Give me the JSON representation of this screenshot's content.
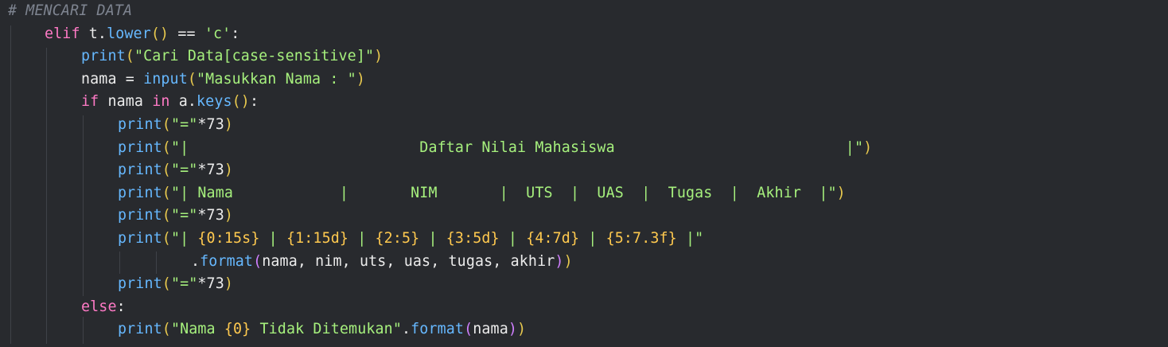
{
  "editor": {
    "lines": [
      {
        "indent": 0,
        "tokens": [
          {
            "t": "comment",
            "v": "# MENCARI DATA"
          }
        ]
      },
      {
        "indent": 1,
        "tokens": [
          {
            "t": "kw",
            "v": "elif"
          },
          {
            "t": "plain",
            "v": " t."
          },
          {
            "t": "fn",
            "v": "lower"
          },
          {
            "t": "paren",
            "v": "()"
          },
          {
            "t": "plain",
            "v": " == "
          },
          {
            "t": "str",
            "v": "'c'"
          },
          {
            "t": "plain",
            "v": ":"
          }
        ]
      },
      {
        "indent": 2,
        "tokens": [
          {
            "t": "fn",
            "v": "print"
          },
          {
            "t": "paren",
            "v": "("
          },
          {
            "t": "str",
            "v": "\"Cari Data[case-sensitive]\""
          },
          {
            "t": "paren",
            "v": ")"
          }
        ]
      },
      {
        "indent": 2,
        "tokens": [
          {
            "t": "plain",
            "v": "nama = "
          },
          {
            "t": "fn",
            "v": "input"
          },
          {
            "t": "paren",
            "v": "("
          },
          {
            "t": "str",
            "v": "\"Masukkan Nama : \""
          },
          {
            "t": "paren",
            "v": ")"
          }
        ]
      },
      {
        "indent": 2,
        "tokens": [
          {
            "t": "kw",
            "v": "if"
          },
          {
            "t": "plain",
            "v": " nama "
          },
          {
            "t": "kw",
            "v": "in"
          },
          {
            "t": "plain",
            "v": " a."
          },
          {
            "t": "fn",
            "v": "keys"
          },
          {
            "t": "paren",
            "v": "()"
          },
          {
            "t": "plain",
            "v": ":"
          }
        ]
      },
      {
        "indent": 3,
        "tokens": [
          {
            "t": "fn",
            "v": "print"
          },
          {
            "t": "paren",
            "v": "("
          },
          {
            "t": "str",
            "v": "\"=\""
          },
          {
            "t": "plain",
            "v": "*73"
          },
          {
            "t": "paren",
            "v": ")"
          }
        ]
      },
      {
        "indent": 3,
        "tokens": [
          {
            "t": "fn",
            "v": "print"
          },
          {
            "t": "paren",
            "v": "("
          },
          {
            "t": "str",
            "v": "\"|                          Daftar Nilai Mahasiswa                          |\""
          },
          {
            "t": "paren",
            "v": ")"
          }
        ]
      },
      {
        "indent": 3,
        "tokens": [
          {
            "t": "fn",
            "v": "print"
          },
          {
            "t": "paren",
            "v": "("
          },
          {
            "t": "str",
            "v": "\"=\""
          },
          {
            "t": "plain",
            "v": "*73"
          },
          {
            "t": "paren",
            "v": ")"
          }
        ]
      },
      {
        "indent": 3,
        "tokens": [
          {
            "t": "fn",
            "v": "print"
          },
          {
            "t": "paren",
            "v": "("
          },
          {
            "t": "str",
            "v": "\"| Nama            |       NIM       |  UTS  |  UAS  |  Tugas  |  Akhir  |\""
          },
          {
            "t": "paren",
            "v": ")"
          }
        ]
      },
      {
        "indent": 3,
        "tokens": [
          {
            "t": "fn",
            "v": "print"
          },
          {
            "t": "paren",
            "v": "("
          },
          {
            "t": "str",
            "v": "\"=\""
          },
          {
            "t": "plain",
            "v": "*73"
          },
          {
            "t": "paren",
            "v": ")"
          }
        ]
      },
      {
        "indent": 3,
        "tokens": [
          {
            "t": "fn",
            "v": "print"
          },
          {
            "t": "paren",
            "v": "("
          },
          {
            "t": "str",
            "v": "\"| "
          },
          {
            "t": "fmt",
            "v": "{0:15s}"
          },
          {
            "t": "str",
            "v": " | "
          },
          {
            "t": "fmt",
            "v": "{1:15d}"
          },
          {
            "t": "str",
            "v": " | "
          },
          {
            "t": "fmt",
            "v": "{2:5}"
          },
          {
            "t": "str",
            "v": " | "
          },
          {
            "t": "fmt",
            "v": "{3:5d}"
          },
          {
            "t": "str",
            "v": " | "
          },
          {
            "t": "fmt",
            "v": "{4:7d}"
          },
          {
            "t": "str",
            "v": " | "
          },
          {
            "t": "fmt",
            "v": "{5:7.3f}"
          },
          {
            "t": "str",
            "v": " |\""
          }
        ]
      },
      {
        "indent": 5,
        "tokens": [
          {
            "t": "plain",
            "v": "."
          },
          {
            "t": "fn",
            "v": "format"
          },
          {
            "t": "paren2",
            "v": "("
          },
          {
            "t": "plain",
            "v": "nama, nim, uts, uas, tugas, akhir"
          },
          {
            "t": "paren2",
            "v": ")"
          },
          {
            "t": "paren",
            "v": ")"
          }
        ]
      },
      {
        "indent": 3,
        "tokens": [
          {
            "t": "fn",
            "v": "print"
          },
          {
            "t": "paren",
            "v": "("
          },
          {
            "t": "str",
            "v": "\"=\""
          },
          {
            "t": "plain",
            "v": "*73"
          },
          {
            "t": "paren",
            "v": ")"
          }
        ]
      },
      {
        "indent": 2,
        "tokens": [
          {
            "t": "kw",
            "v": "else"
          },
          {
            "t": "plain",
            "v": ":"
          }
        ]
      },
      {
        "indent": 3,
        "tokens": [
          {
            "t": "fn",
            "v": "print"
          },
          {
            "t": "paren",
            "v": "("
          },
          {
            "t": "str",
            "v": "\"Nama "
          },
          {
            "t": "fmt",
            "v": "{0}"
          },
          {
            "t": "str",
            "v": " Tidak Ditemukan\""
          },
          {
            "t": "plain",
            "v": "."
          },
          {
            "t": "fn",
            "v": "format"
          },
          {
            "t": "paren2",
            "v": "("
          },
          {
            "t": "plain",
            "v": "nama"
          },
          {
            "t": "paren2",
            "v": ")"
          },
          {
            "t": "paren",
            "v": ")"
          }
        ]
      }
    ]
  },
  "colors": {
    "background": "#282a2e",
    "comment": "#7e8490",
    "keyword": "#ff7ac6",
    "function": "#66b8ff",
    "string": "#a6f07d",
    "format_placeholder": "#ffc94f",
    "paren": "#e8c94e",
    "paren_nested": "#d07fff",
    "plain": "#ececec",
    "indent_guide": "#3f4248"
  }
}
